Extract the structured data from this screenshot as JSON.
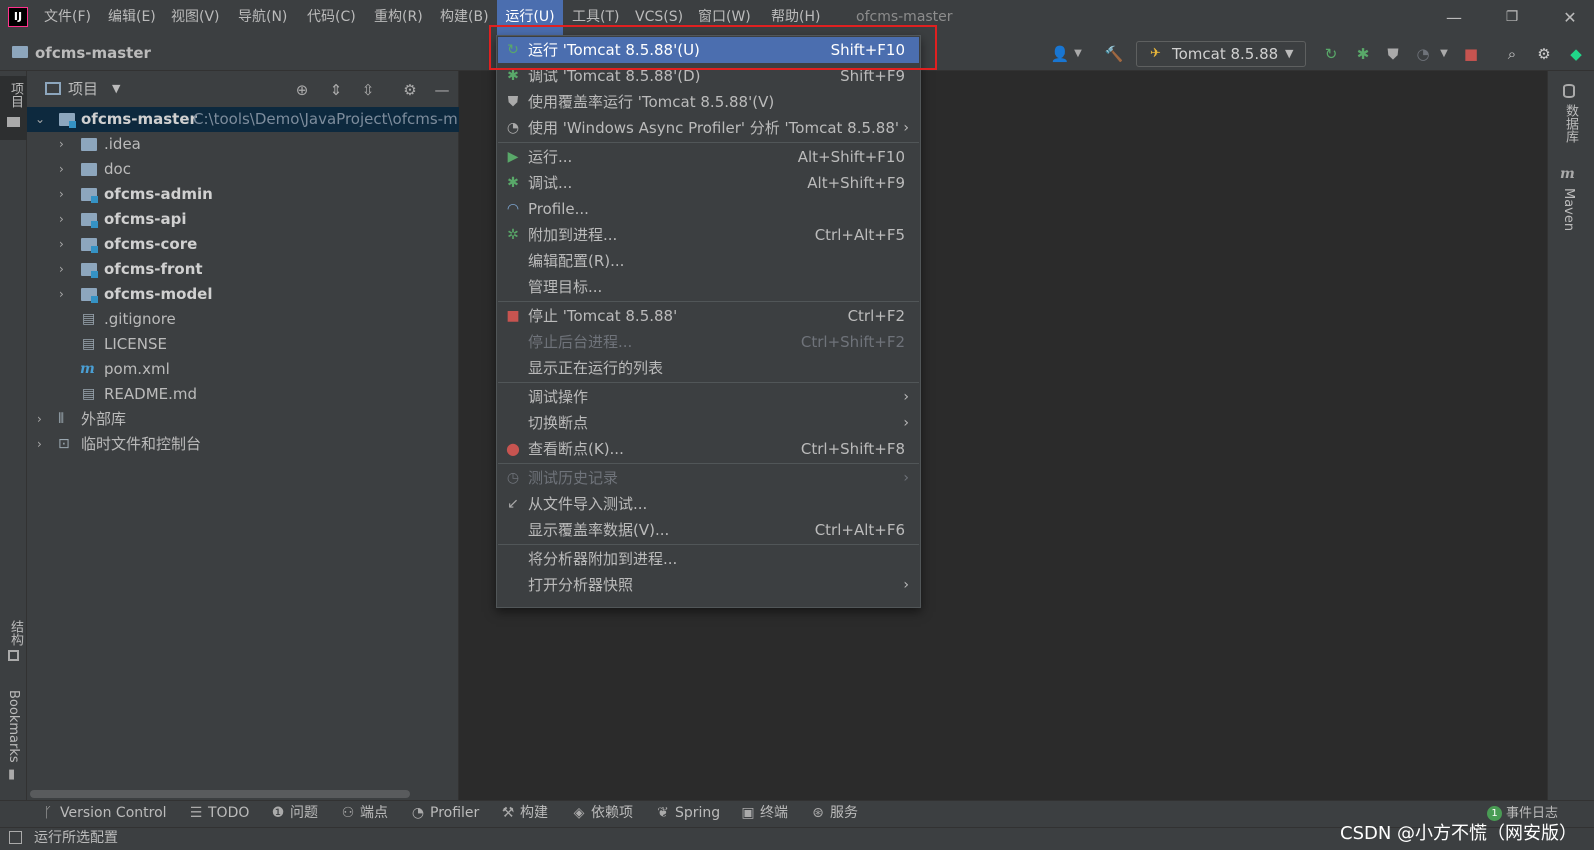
{
  "menubar": {
    "items": [
      "文件(F)",
      "编辑(E)",
      "视图(V)",
      "导航(N)",
      "代码(C)",
      "重构(R)",
      "构建(B)",
      "运行(U)",
      "工具(T)",
      "VCS(S)",
      "窗口(W)",
      "帮助(H)"
    ],
    "active": "运行(U)",
    "window_title": "ofcms-master",
    "app_logo": "IJ"
  },
  "navbar": {
    "project": "ofcms-master",
    "run_config": "Tomcat 8.5.88"
  },
  "left_strip": {
    "project_tab": "项目",
    "structure_tab": "结构",
    "bookmarks_tab": "Bookmarks"
  },
  "right_strip": {
    "database_tab": "数据库",
    "maven_tab": "Maven"
  },
  "project_panel": {
    "title": "项目",
    "root": {
      "name": "ofcms-master",
      "path": "C:\\tools\\Demo\\JavaProject\\ofcms-m"
    },
    "children": [
      {
        "name": ".idea",
        "kind": "folder"
      },
      {
        "name": "doc",
        "kind": "folder"
      },
      {
        "name": "ofcms-admin",
        "kind": "module"
      },
      {
        "name": "ofcms-api",
        "kind": "module"
      },
      {
        "name": "ofcms-core",
        "kind": "module"
      },
      {
        "name": "ofcms-front",
        "kind": "module"
      },
      {
        "name": "ofcms-model",
        "kind": "module"
      },
      {
        "name": ".gitignore",
        "kind": "file"
      },
      {
        "name": "LICENSE",
        "kind": "file"
      },
      {
        "name": "pom.xml",
        "kind": "maven"
      },
      {
        "name": "README.md",
        "kind": "markdown"
      }
    ],
    "external_libs": "外部库",
    "scratches": "临时文件和控制台"
  },
  "run_menu": {
    "items": [
      {
        "label": "运行 'Tomcat 8.5.88'(U)",
        "shortcut": "Shift+F10",
        "icon": "rerun-icon",
        "highlighted": true
      },
      {
        "label": "调试 'Tomcat 8.5.88'(D)",
        "shortcut": "Shift+F9",
        "icon": "debug-icon"
      },
      {
        "label": "使用覆盖率运行 'Tomcat 8.5.88'(V)",
        "shortcut": "",
        "icon": "coverage-icon"
      },
      {
        "label": "使用 'Windows Async Profiler' 分析 'Tomcat 8.5.88'",
        "shortcut": "",
        "icon": "profiler-icon",
        "submenu": true
      },
      {
        "label": "运行...",
        "shortcut": "Alt+Shift+F10",
        "icon": "run-icon"
      },
      {
        "label": "调试...",
        "shortcut": "Alt+Shift+F9",
        "icon": "debug-icon"
      },
      {
        "label": "Profile...",
        "shortcut": "",
        "icon": "profile-gauge-icon"
      },
      {
        "label": "附加到进程...",
        "shortcut": "Ctrl+Alt+F5",
        "icon": "attach-debug-icon"
      },
      {
        "label": "编辑配置(R)...",
        "shortcut": "",
        "icon": ""
      },
      {
        "label": "管理目标...",
        "shortcut": "",
        "icon": ""
      },
      {
        "label": "停止 'Tomcat 8.5.88'",
        "shortcut": "Ctrl+F2",
        "icon": "stop-icon"
      },
      {
        "label": "停止后台进程...",
        "shortcut": "Ctrl+Shift+F2",
        "icon": "",
        "disabled": true
      },
      {
        "label": "显示正在运行的列表",
        "shortcut": "",
        "icon": ""
      },
      {
        "label": "调试操作",
        "shortcut": "",
        "icon": "",
        "submenu": true
      },
      {
        "label": "切换断点",
        "shortcut": "",
        "icon": "",
        "submenu": true
      },
      {
        "label": "查看断点(K)...",
        "shortcut": "Ctrl+Shift+F8",
        "icon": "breakpoints-icon"
      },
      {
        "label": "测试历史记录",
        "shortcut": "",
        "icon": "history-icon",
        "submenu": true,
        "disabled": true
      },
      {
        "label": "从文件导入测试...",
        "shortcut": "",
        "icon": "import-icon"
      },
      {
        "label": "显示覆盖率数据(V)...",
        "shortcut": "Ctrl+Alt+F6",
        "icon": ""
      },
      {
        "label": "将分析器附加到进程...",
        "shortcut": "",
        "icon": ""
      },
      {
        "label": "打开分析器快照",
        "shortcut": "",
        "icon": "",
        "submenu": true
      }
    ]
  },
  "bottom_tools": [
    {
      "label": "Version Control",
      "icon": "branch-icon"
    },
    {
      "label": "TODO",
      "icon": "list-icon"
    },
    {
      "label": "问题",
      "icon": "info-icon"
    },
    {
      "label": "端点",
      "icon": "endpoints-icon"
    },
    {
      "label": "Profiler",
      "icon": "profiler-icon"
    },
    {
      "label": "构建",
      "icon": "hammer-icon"
    },
    {
      "label": "依赖项",
      "icon": "layers-icon"
    },
    {
      "label": "Spring",
      "icon": "spring-leaf-icon"
    },
    {
      "label": "终端",
      "icon": "terminal-icon"
    },
    {
      "label": "服务",
      "icon": "services-icon"
    }
  ],
  "event_log": {
    "count": "1",
    "label": "事件日志"
  },
  "status": {
    "text": "运行所选配置"
  },
  "watermark": "CSDN @小方不慌（网安版）",
  "colors": {
    "accent": "#4b6eaf",
    "highlight_box": "#e02020",
    "bg": "#2b2b2b",
    "panel": "#3c3f41"
  }
}
